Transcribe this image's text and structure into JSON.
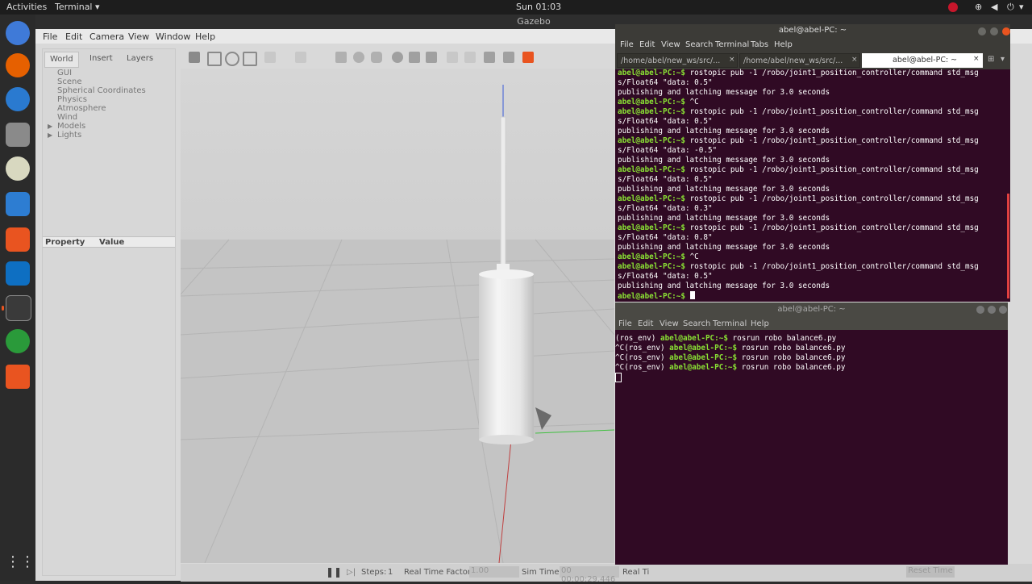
{
  "topbar": {
    "activities": "Activities",
    "app_menu": "Terminal ▾",
    "clock": "Sun 01:03"
  },
  "gazebo": {
    "window_title": "Gazebo",
    "menu": [
      "File",
      "Edit",
      "Camera",
      "View",
      "Window",
      "Help"
    ],
    "tabs": [
      "World",
      "Insert",
      "Layers"
    ],
    "tree": [
      "GUI",
      "Scene",
      "Spherical Coordinates",
      "Physics",
      "Atmosphere",
      "Wind",
      "Models",
      "Lights"
    ],
    "property_header": "Property",
    "value_header": "Value",
    "bottom": {
      "steps_label": "Steps:",
      "steps_value": "1",
      "rtf_label": "Real Time Factor:",
      "rtf_value": "1.00",
      "sim_time_label": "Sim Time:",
      "sim_time_value": "00 00:00:29.446",
      "real_time_label": "Real Ti",
      "reset_label": "Reset Time"
    }
  },
  "terminal1": {
    "title": "abel@abel-PC: ~",
    "menu": [
      "File",
      "Edit",
      "View",
      "Search",
      "Terminal",
      "Tabs",
      "Help"
    ],
    "tabs": [
      "/home/abel/new_ws/src/...",
      "/home/abel/new_ws/src/...",
      "abel@abel-PC: ~"
    ],
    "lines": [
      {
        "p": "abel@abel-PC:~$ ",
        "t": "rostopic pub -1 /robo/joint1_position_controller/command std_msg"
      },
      {
        "p": "",
        "t": "s/Float64 \"data: 0.5\""
      },
      {
        "p": "",
        "t": "publishing and latching message for 3.0 seconds"
      },
      {
        "p": "abel@abel-PC:~$ ",
        "t": "^C"
      },
      {
        "p": "abel@abel-PC:~$ ",
        "t": "rostopic pub -1 /robo/joint1_position_controller/command std_msg"
      },
      {
        "p": "",
        "t": "s/Float64 \"data: 0.5\""
      },
      {
        "p": "",
        "t": "publishing and latching message for 3.0 seconds"
      },
      {
        "p": "abel@abel-PC:~$ ",
        "t": "rostopic pub -1 /robo/joint1_position_controller/command std_msg"
      },
      {
        "p": "",
        "t": "s/Float64 \"data: -0.5\""
      },
      {
        "p": "",
        "t": "publishing and latching message for 3.0 seconds"
      },
      {
        "p": "abel@abel-PC:~$ ",
        "t": "rostopic pub -1 /robo/joint1_position_controller/command std_msg"
      },
      {
        "p": "",
        "t": "s/Float64 \"data: 0.5\""
      },
      {
        "p": "",
        "t": "publishing and latching message for 3.0 seconds"
      },
      {
        "p": "abel@abel-PC:~$ ",
        "t": "rostopic pub -1 /robo/joint1_position_controller/command std_msg"
      },
      {
        "p": "",
        "t": "s/Float64 \"data: 0.3\""
      },
      {
        "p": "",
        "t": "publishing and latching message for 3.0 seconds"
      },
      {
        "p": "abel@abel-PC:~$ ",
        "t": "rostopic pub -1 /robo/joint1_position_controller/command std_msg"
      },
      {
        "p": "",
        "t": "s/Float64 \"data: 0.8\""
      },
      {
        "p": "",
        "t": "publishing and latching message for 3.0 seconds"
      },
      {
        "p": "abel@abel-PC:~$ ",
        "t": "^C"
      },
      {
        "p": "abel@abel-PC:~$ ",
        "t": "rostopic pub -1 /robo/joint1_position_controller/command std_msg"
      },
      {
        "p": "",
        "t": "s/Float64 \"data: 0.5\""
      },
      {
        "p": "",
        "t": "publishing and latching message for 3.0 seconds"
      },
      {
        "p": "abel@abel-PC:~$ ",
        "t": ""
      }
    ]
  },
  "terminal2": {
    "title": "abel@abel-PC: ~",
    "menu": [
      "File",
      "Edit",
      "View",
      "Search",
      "Terminal",
      "Help"
    ],
    "lines": [
      {
        "a": "(ros_env) ",
        "p": "abel@abel-PC:~$ ",
        "t": "rosrun robo balance6.py"
      },
      {
        "a": "^C(ros_env) ",
        "p": "abel@abel-PC:~$ ",
        "t": "rosrun robo balance6.py"
      },
      {
        "a": "^C(ros_env) ",
        "p": "abel@abel-PC:~$ ",
        "t": "rosrun robo balance6.py"
      },
      {
        "a": "^C(ros_env) ",
        "p": "abel@abel-PC:~$ ",
        "t": "rosrun robo balance6.py"
      }
    ]
  },
  "colors": {
    "terminal_bg": "#300a24",
    "prompt": "#8ae234",
    "ubuntu_orange": "#e95420"
  }
}
